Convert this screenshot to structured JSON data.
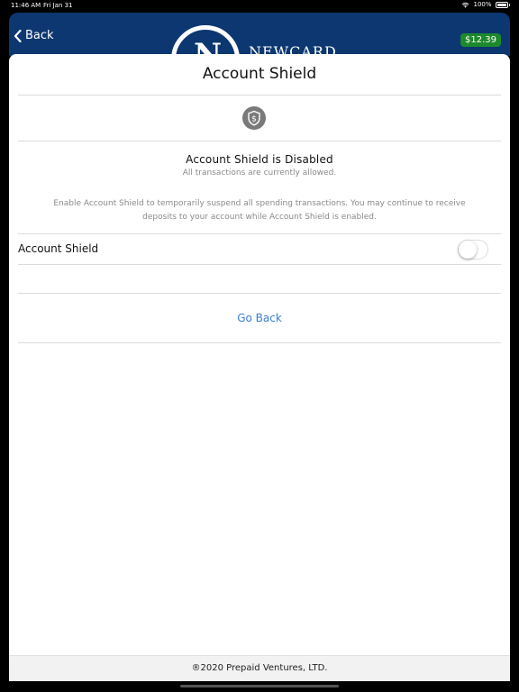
{
  "status_bar": {
    "time": "11:46 AM",
    "date": "Fri Jan 31",
    "battery": "100%"
  },
  "header": {
    "back_label": "Back",
    "logo_letter": "N",
    "logo_text": "NEWCARD",
    "balance": "$12.39"
  },
  "page": {
    "title": "Account Shield"
  },
  "shield": {
    "status_title": "Account Shield is Disabled",
    "status_subtitle": "All transactions are currently allowed."
  },
  "description": "Enable Account Shield to temporarily suspend all spending transactions. You may continue to receive deposits to your account while Account Shield is enabled.",
  "setting": {
    "label": "Account Shield",
    "enabled": false
  },
  "actions": {
    "go_back_label": "Go Back"
  },
  "footer": {
    "copyright": "®2020 Prepaid Ventures, LTD."
  },
  "colors": {
    "header_bg": "#0d3770",
    "balance_bg": "#1c8a2c",
    "link": "#3a7ed8"
  }
}
